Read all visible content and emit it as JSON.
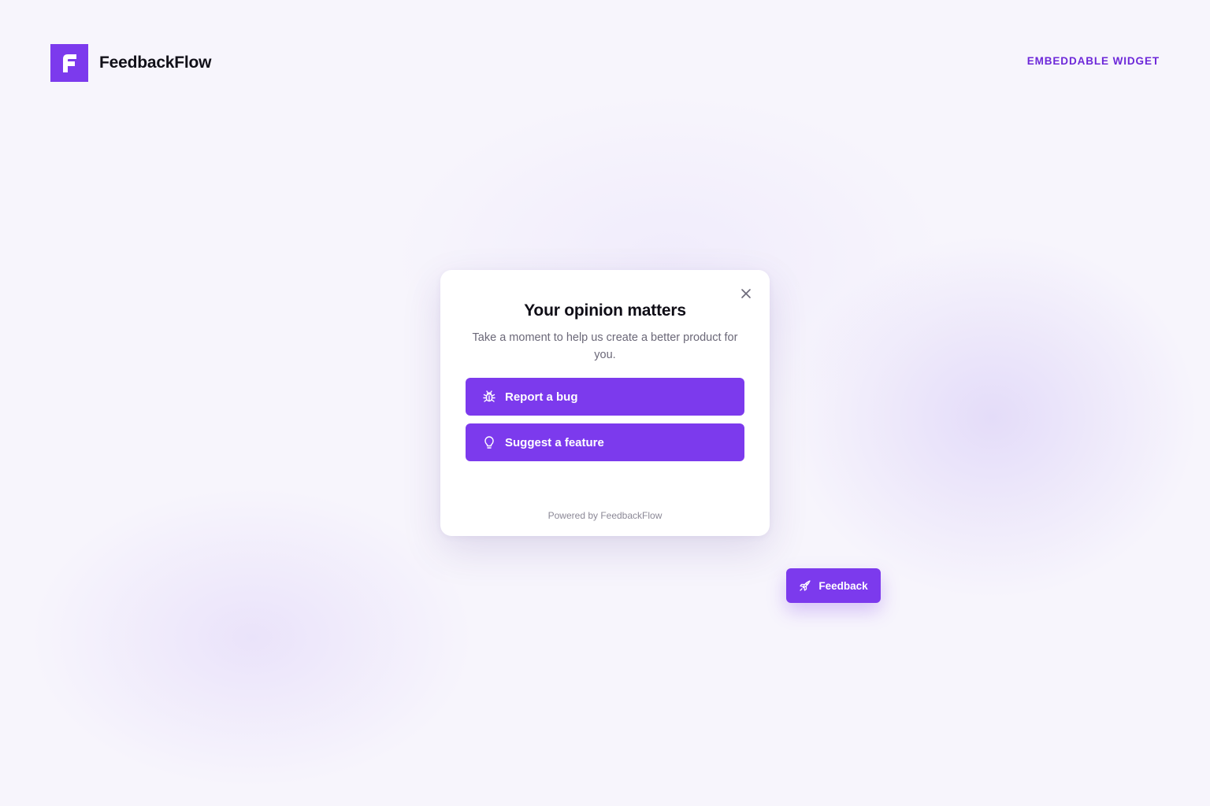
{
  "brand": {
    "name": "FeedbackFlow",
    "logo_letter": "F",
    "logo_icon": "feedbackflow-logo-icon"
  },
  "header": {
    "tag": "EMBEDDABLE WIDGET"
  },
  "modal": {
    "title": "Your opinion matters",
    "subtitle": "Take a moment to help us create a better product for you.",
    "close_icon": "close-icon",
    "actions": [
      {
        "label": "Report a bug",
        "icon": "bug-icon"
      },
      {
        "label": "Suggest a feature",
        "icon": "lightbulb-icon"
      }
    ],
    "powered_by": "Powered by FeedbackFlow"
  },
  "fab": {
    "label": "Feedback",
    "icon": "rocket-icon"
  },
  "colors": {
    "accent": "#7c3aed",
    "accent_text": "#6d28d9",
    "background": "#f7f5fc",
    "modal_bg": "#ffffff",
    "title_text": "#0f0d16",
    "muted_text": "#6b6878"
  }
}
